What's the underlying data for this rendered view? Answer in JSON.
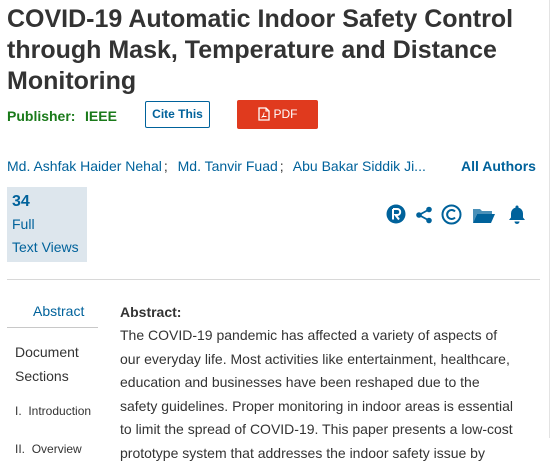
{
  "paper": {
    "title": "COVID-19 Automatic Indoor Safety Control through Mask, Temperature and Distance Monitoring",
    "publisher_label": "Publisher:",
    "publisher": "IEEE",
    "cite_label": "Cite This",
    "pdf_label": "PDF",
    "authors": [
      "Md. Ashfak Haider Nehal",
      "Md. Tanvir Fuad",
      "Abu Bakar Siddik Ji..."
    ],
    "author_sep": ";",
    "all_authors_label": "All Authors"
  },
  "metrics": {
    "count": "34",
    "label_line1": "Full",
    "label_line2": "Text Views"
  },
  "icons": [
    "rights-icon",
    "share-icon",
    "copyright-icon",
    "folder-icon",
    "bell-icon"
  ],
  "colors": {
    "link": "#00629b",
    "publisher": "#1a7a1a",
    "pdf": "#e03a1e",
    "metrics_bg": "#dde6ed"
  },
  "sidebar": {
    "abstract": "Abstract",
    "document_sections": "Document Sections",
    "items": [
      {
        "num": "I.",
        "label": "Introduction"
      },
      {
        "num": "II.",
        "label": "Overview"
      }
    ]
  },
  "abstract": {
    "heading": "Abstract:",
    "text": "The COVID-19 pandemic has affected a variety of aspects of our everyday life. Most activities like entertainment, healthcare, education and businesses have been reshaped due to the safety guidelines. Proper monitoring in indoor areas is essential to limit the spread of COVID-19. This paper presents a low-cost prototype system that addresses the indoor safety issue by"
  }
}
